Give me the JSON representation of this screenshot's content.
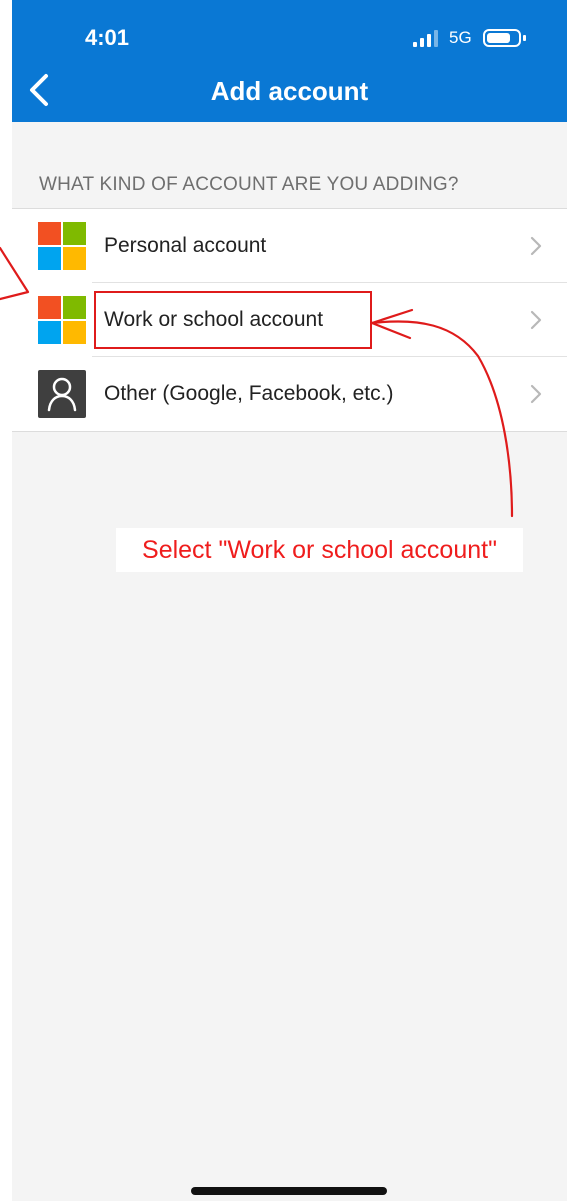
{
  "status_bar": {
    "time": "4:01",
    "network": "5G"
  },
  "nav": {
    "title": "Add account",
    "back_icon": "chevron-left-icon"
  },
  "section_header": "WHAT KIND OF ACCOUNT ARE YOU ADDING?",
  "accounts": [
    {
      "label": "Personal account",
      "icon": "microsoft-logo-icon"
    },
    {
      "label": "Work or school account",
      "icon": "microsoft-logo-icon"
    },
    {
      "label": "Other (Google, Facebook, etc.)",
      "icon": "person-icon"
    }
  ],
  "annotation": {
    "instruction": "Select \"Work or school account\""
  },
  "colors": {
    "header_blue": "#0a78d4",
    "page_background": "#f4f4f4",
    "annotation_red": "#df1b1b",
    "microsoft_red": "#f25022",
    "microsoft_green": "#7fba00",
    "microsoft_blue": "#00a4ef",
    "microsoft_yellow": "#ffb900"
  }
}
